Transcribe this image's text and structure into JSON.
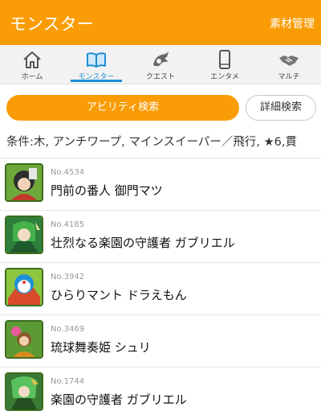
{
  "header": {
    "title": "モンスター",
    "action": "素材管理"
  },
  "tabs": [
    {
      "label": "ホーム",
      "icon": "home-icon"
    },
    {
      "label": "モンスター",
      "icon": "book-icon"
    },
    {
      "label": "クエスト",
      "icon": "dragon-icon"
    },
    {
      "label": "エンタメ",
      "icon": "phone-icon"
    },
    {
      "label": "マルチ",
      "icon": "handshake-icon"
    }
  ],
  "search": {
    "ability_button": "アビリティ検索",
    "detail_button": "詳細検索"
  },
  "condition": "条件:木, アンチワープ, マインスイーパー／飛行, ★6,貫",
  "monsters": [
    {
      "no": "No.4534",
      "name": "門前の番人 御門マツ"
    },
    {
      "no": "No.4185",
      "name": "壮烈なる楽園の守護者 ガブリエル"
    },
    {
      "no": "No.3942",
      "name": "ひらりマント ドラえもん"
    },
    {
      "no": "No.3469",
      "name": "琉球舞奏姫 シュリ"
    },
    {
      "no": "No.1744",
      "name": "楽園の守護者 ガブリエル"
    }
  ],
  "colors": {
    "accent": "#fa9c05",
    "active_tab": "#1d8fd6"
  }
}
